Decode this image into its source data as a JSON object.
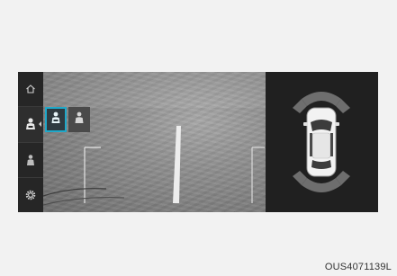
{
  "figure_code": "OUS4071139L",
  "rail": {
    "items": [
      {
        "name": "home",
        "icon": "home-icon"
      },
      {
        "name": "camera-view",
        "icon": "camera-view-icon",
        "active": true
      },
      {
        "name": "parking-guide",
        "icon": "parking-guide-icon"
      },
      {
        "name": "settings",
        "icon": "gear-icon"
      }
    ]
  },
  "camera_view": {
    "options": [
      {
        "icon": "rear-view-icon",
        "selected": true
      },
      {
        "icon": "top-view-icon",
        "selected": false
      }
    ],
    "accent_color": "#1fa8c9"
  },
  "sensor_panel": {
    "vehicle_icon": "car-top-icon",
    "zone_color": "#6e6e6e"
  }
}
